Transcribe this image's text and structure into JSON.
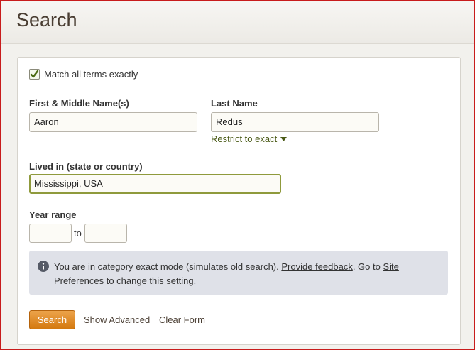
{
  "header": {
    "title": "Search"
  },
  "form": {
    "match_exact": {
      "label": "Match all terms exactly",
      "checked": true
    },
    "first_name": {
      "label": "First & Middle Name(s)",
      "value": "Aaron"
    },
    "last_name": {
      "label": "Last Name",
      "value": "Redus",
      "restrict_label": "Restrict to exact"
    },
    "lived_in": {
      "label": "Lived in (state or country)",
      "value": "Mississippi, USA"
    },
    "year_range": {
      "label": "Year range",
      "from": "",
      "to_label": "to",
      "to": ""
    }
  },
  "info": {
    "text_before": "You are in category exact mode (simulates old search).",
    "feedback_link": "Provide feedback",
    "text_middle": ". Go to",
    "prefs_link": "Site Preferences",
    "text_after": "to change this setting."
  },
  "actions": {
    "search_label": "Search",
    "show_advanced": "Show Advanced",
    "clear_form": "Clear Form"
  },
  "colors": {
    "accent_green": "#4a5a16",
    "button_orange": "#d4790f",
    "title_brown": "#4a3e33",
    "info_bg": "#dfe1e8"
  }
}
